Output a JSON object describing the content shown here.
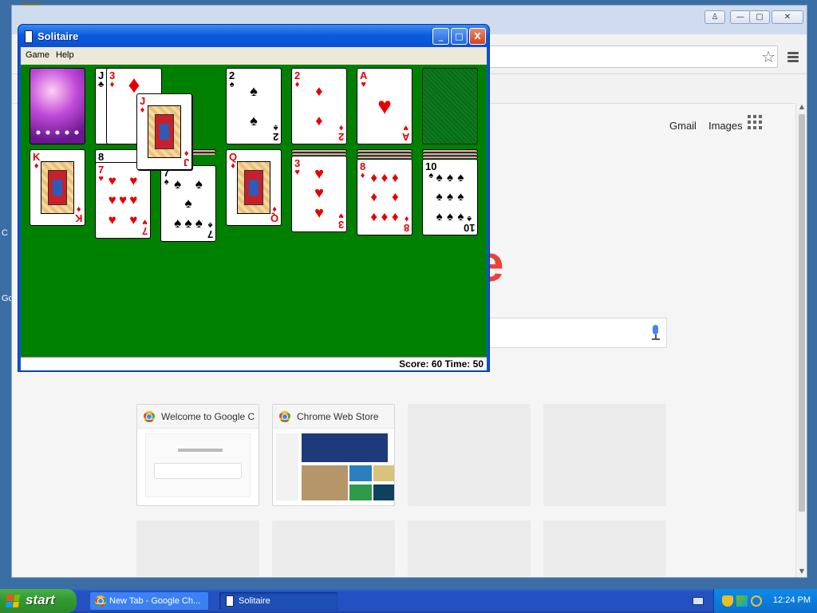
{
  "desktop": {
    "labels": [
      "C",
      "Go"
    ]
  },
  "chrome": {
    "window_controls": {
      "user": "♙",
      "minimize": "—",
      "maximize": "▢",
      "close": "✕"
    },
    "star": "☆",
    "header_links": {
      "gmail": "Gmail",
      "images": "Images"
    },
    "logo_fragment": "e",
    "tiles": [
      {
        "title": "Welcome to Google C",
        "filled": true
      },
      {
        "title": "Chrome Web Store",
        "filled": true
      }
    ]
  },
  "solitaire": {
    "title": "Solitaire",
    "menu": {
      "game": "Game",
      "help": "Help"
    },
    "title_buttons": {
      "minimize": "_",
      "maximize": "□",
      "close": "X"
    },
    "status": "Score: 60 Time: 50",
    "waste": [
      {
        "rank": "J",
        "suit": "♣",
        "color": "black"
      },
      {
        "rank": "3",
        "suit": "♦",
        "color": "red"
      }
    ],
    "dragged_card": {
      "rank": "J",
      "suit": "♦",
      "color": "red"
    },
    "foundations": [
      {
        "rank": "2",
        "suit": "♠",
        "color": "black"
      },
      {
        "rank": "2",
        "suit": "♦",
        "color": "red"
      },
      {
        "rank": "A",
        "suit": "♥",
        "color": "red"
      }
    ],
    "tableau": [
      {
        "top": {
          "rank": "K",
          "suit": "♦",
          "color": "red"
        }
      },
      {
        "under": "8",
        "top": {
          "rank": "7",
          "suit": "♥",
          "color": "red"
        }
      },
      {
        "top": {
          "rank": "7",
          "suit": "♠",
          "color": "black"
        }
      },
      {
        "top": {
          "rank": "Q",
          "suit": "♦",
          "color": "red"
        }
      },
      {
        "top": {
          "rank": "3",
          "suit": "♥",
          "color": "red"
        }
      },
      {
        "top": {
          "rank": "8",
          "suit": "♦",
          "color": "red"
        }
      },
      {
        "top": {
          "rank": "10",
          "suit": "♠",
          "color": "black"
        }
      }
    ]
  },
  "taskbar": {
    "start": "start",
    "tasks": [
      {
        "label": "New Tab - Google Ch...",
        "active": false
      },
      {
        "label": "Solitaire",
        "active": true
      }
    ],
    "clock": "12:24 PM"
  }
}
